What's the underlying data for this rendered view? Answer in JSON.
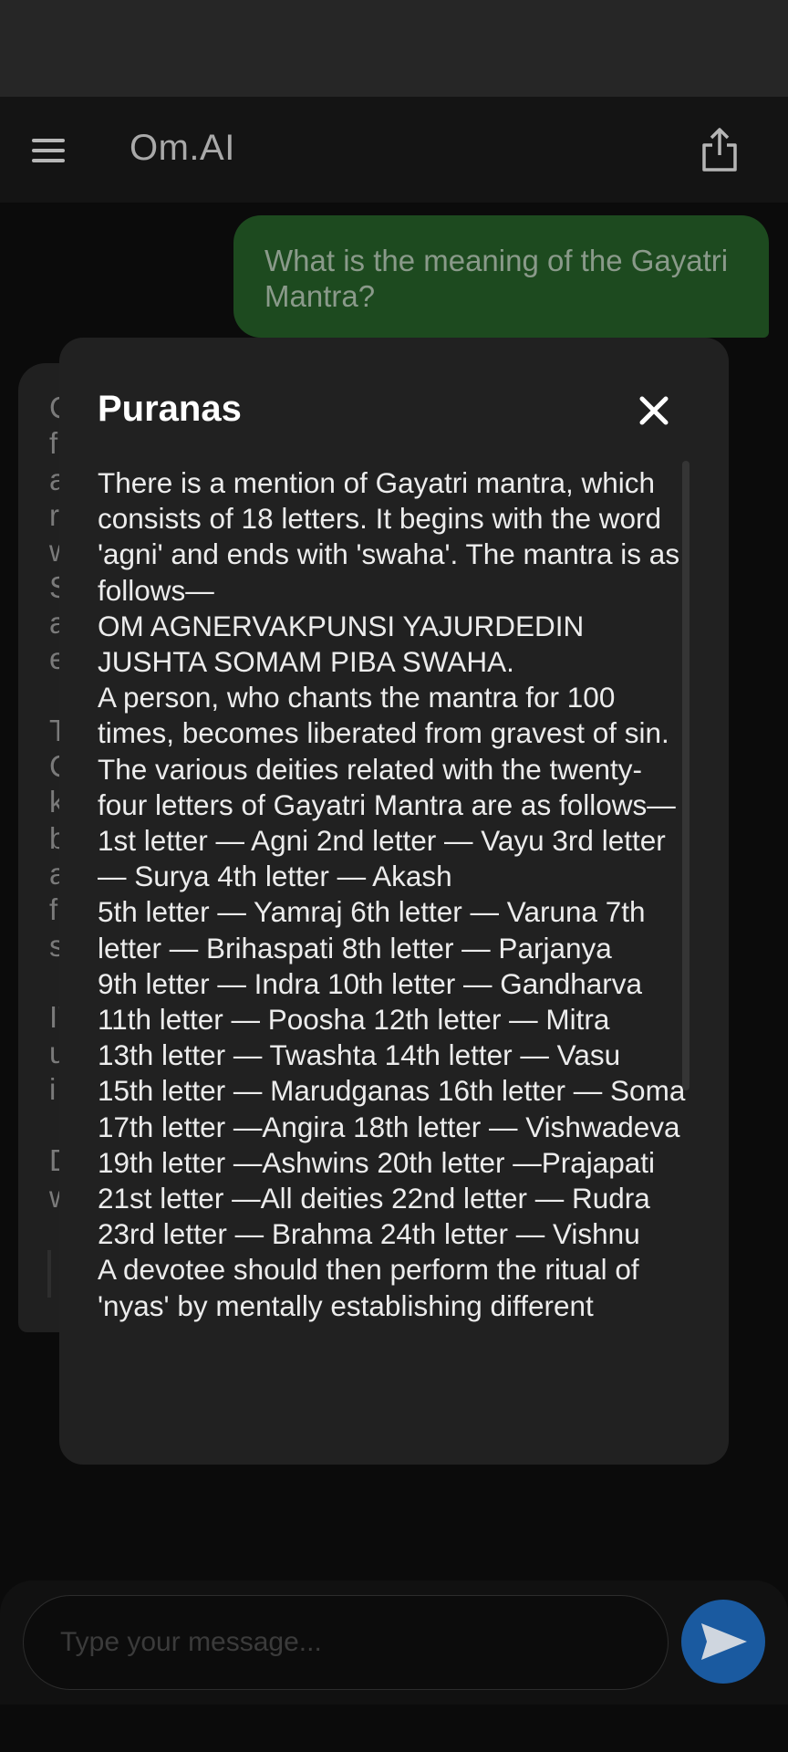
{
  "app": {
    "title": "Om.AI",
    "icons": {
      "menu": "hamburger-menu-icon",
      "share": "share-icon",
      "close": "close-icon",
      "send": "send-icon"
    }
  },
  "chat": {
    "user_message": "What is the meaning of the Gayatri Mantra?",
    "bot_partial_lines": [
      "C",
      "f",
      "a",
      "r",
      "w",
      "S",
      "a",
      "e",
      "",
      "T",
      "C",
      "k",
      "b",
      "a",
      "f",
      "s",
      "",
      "I'",
      "u",
      "i",
      "",
      "D",
      "w"
    ]
  },
  "composer": {
    "placeholder": "Type your message..."
  },
  "modal": {
    "title": "Puranas",
    "body": "There is a mention of Gayatri mantra, which consists of 18 letters. It begins with the word 'agni' and ends with 'swaha'. The mantra is as follows—\nOM AGNERVAKPUNSI YAJURDEDIN JUSHTA SOMAM PIBA SWAHA.\nA person, who chants the mantra for 100 times, becomes liberated from gravest of sin. The various deities related with the twenty-four letters of Gayatri Mantra are as follows—\n1st letter — Agni 2nd letter — Vayu 3rd letter — Surya 4th letter — Akash\n5th letter — Yamraj 6th letter — Varuna 7th letter — Brihaspati 8th letter — Parjanya\n9th letter — Indra 10th letter — Gandharva\n11th letter — Poosha 12th letter — Mitra\n13th letter — Twashta 14th letter — Vasu\n15th letter — Marudganas 16th letter — Soma\n17th letter —Angira 18th letter — Vishwadeva 19th letter —Ashwins 20th letter —Prajapati\n21st letter —All deities 22nd letter — Rudra\n23rd letter — Brahma 24th letter — Vishnu\nA devotee should then perform the ritual of 'nyas' by mentally establishing different"
  },
  "colors": {
    "user_bubble": "#1d4a1f",
    "send_button": "#1a5aa0",
    "modal_bg": "#212121"
  }
}
